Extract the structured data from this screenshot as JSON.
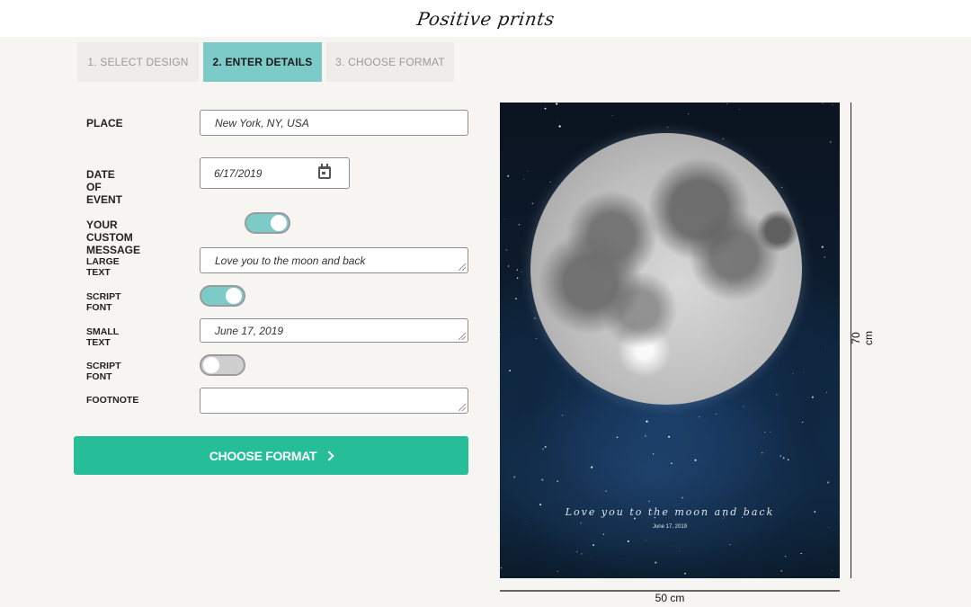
{
  "header": {
    "logo_text": "Positive prints"
  },
  "steps": [
    {
      "label": "1. SELECT DESIGN",
      "active": false
    },
    {
      "label": "2. ENTER DETAILS",
      "active": true
    },
    {
      "label": "3. CHOOSE FORMAT",
      "active": false
    }
  ],
  "form": {
    "place": {
      "label": "PLACE",
      "value": "New York, NY, USA"
    },
    "date": {
      "label": "DATE OF EVENT",
      "value": "6/17/2019",
      "icon": "calendar-icon"
    },
    "custom_message": {
      "label": "YOUR CUSTOM MESSAGE",
      "enabled": true
    },
    "large_text": {
      "label": "LARGE TEXT",
      "value": "Love you to the moon and back"
    },
    "large_script_font": {
      "label": "SCRIPT FONT",
      "enabled": true
    },
    "small_text": {
      "label": "SMALL TEXT",
      "value": "June 17, 2019"
    },
    "small_script_font": {
      "label": "SCRIPT FONT",
      "enabled": false
    },
    "footnote": {
      "label": "FOOTNOTE",
      "value": ""
    },
    "submit_label": "CHOOSE FORMAT",
    "submit_icon": "chevron-right-icon"
  },
  "preview": {
    "message": "Love you to the moon and back",
    "date": "June 17, 2019",
    "height_label": "70 cm",
    "width_label": "50 cm"
  },
  "colors": {
    "accent_teal": "#7ccbc9",
    "cta_green": "#26bd99",
    "background": "#f6f5f1"
  }
}
